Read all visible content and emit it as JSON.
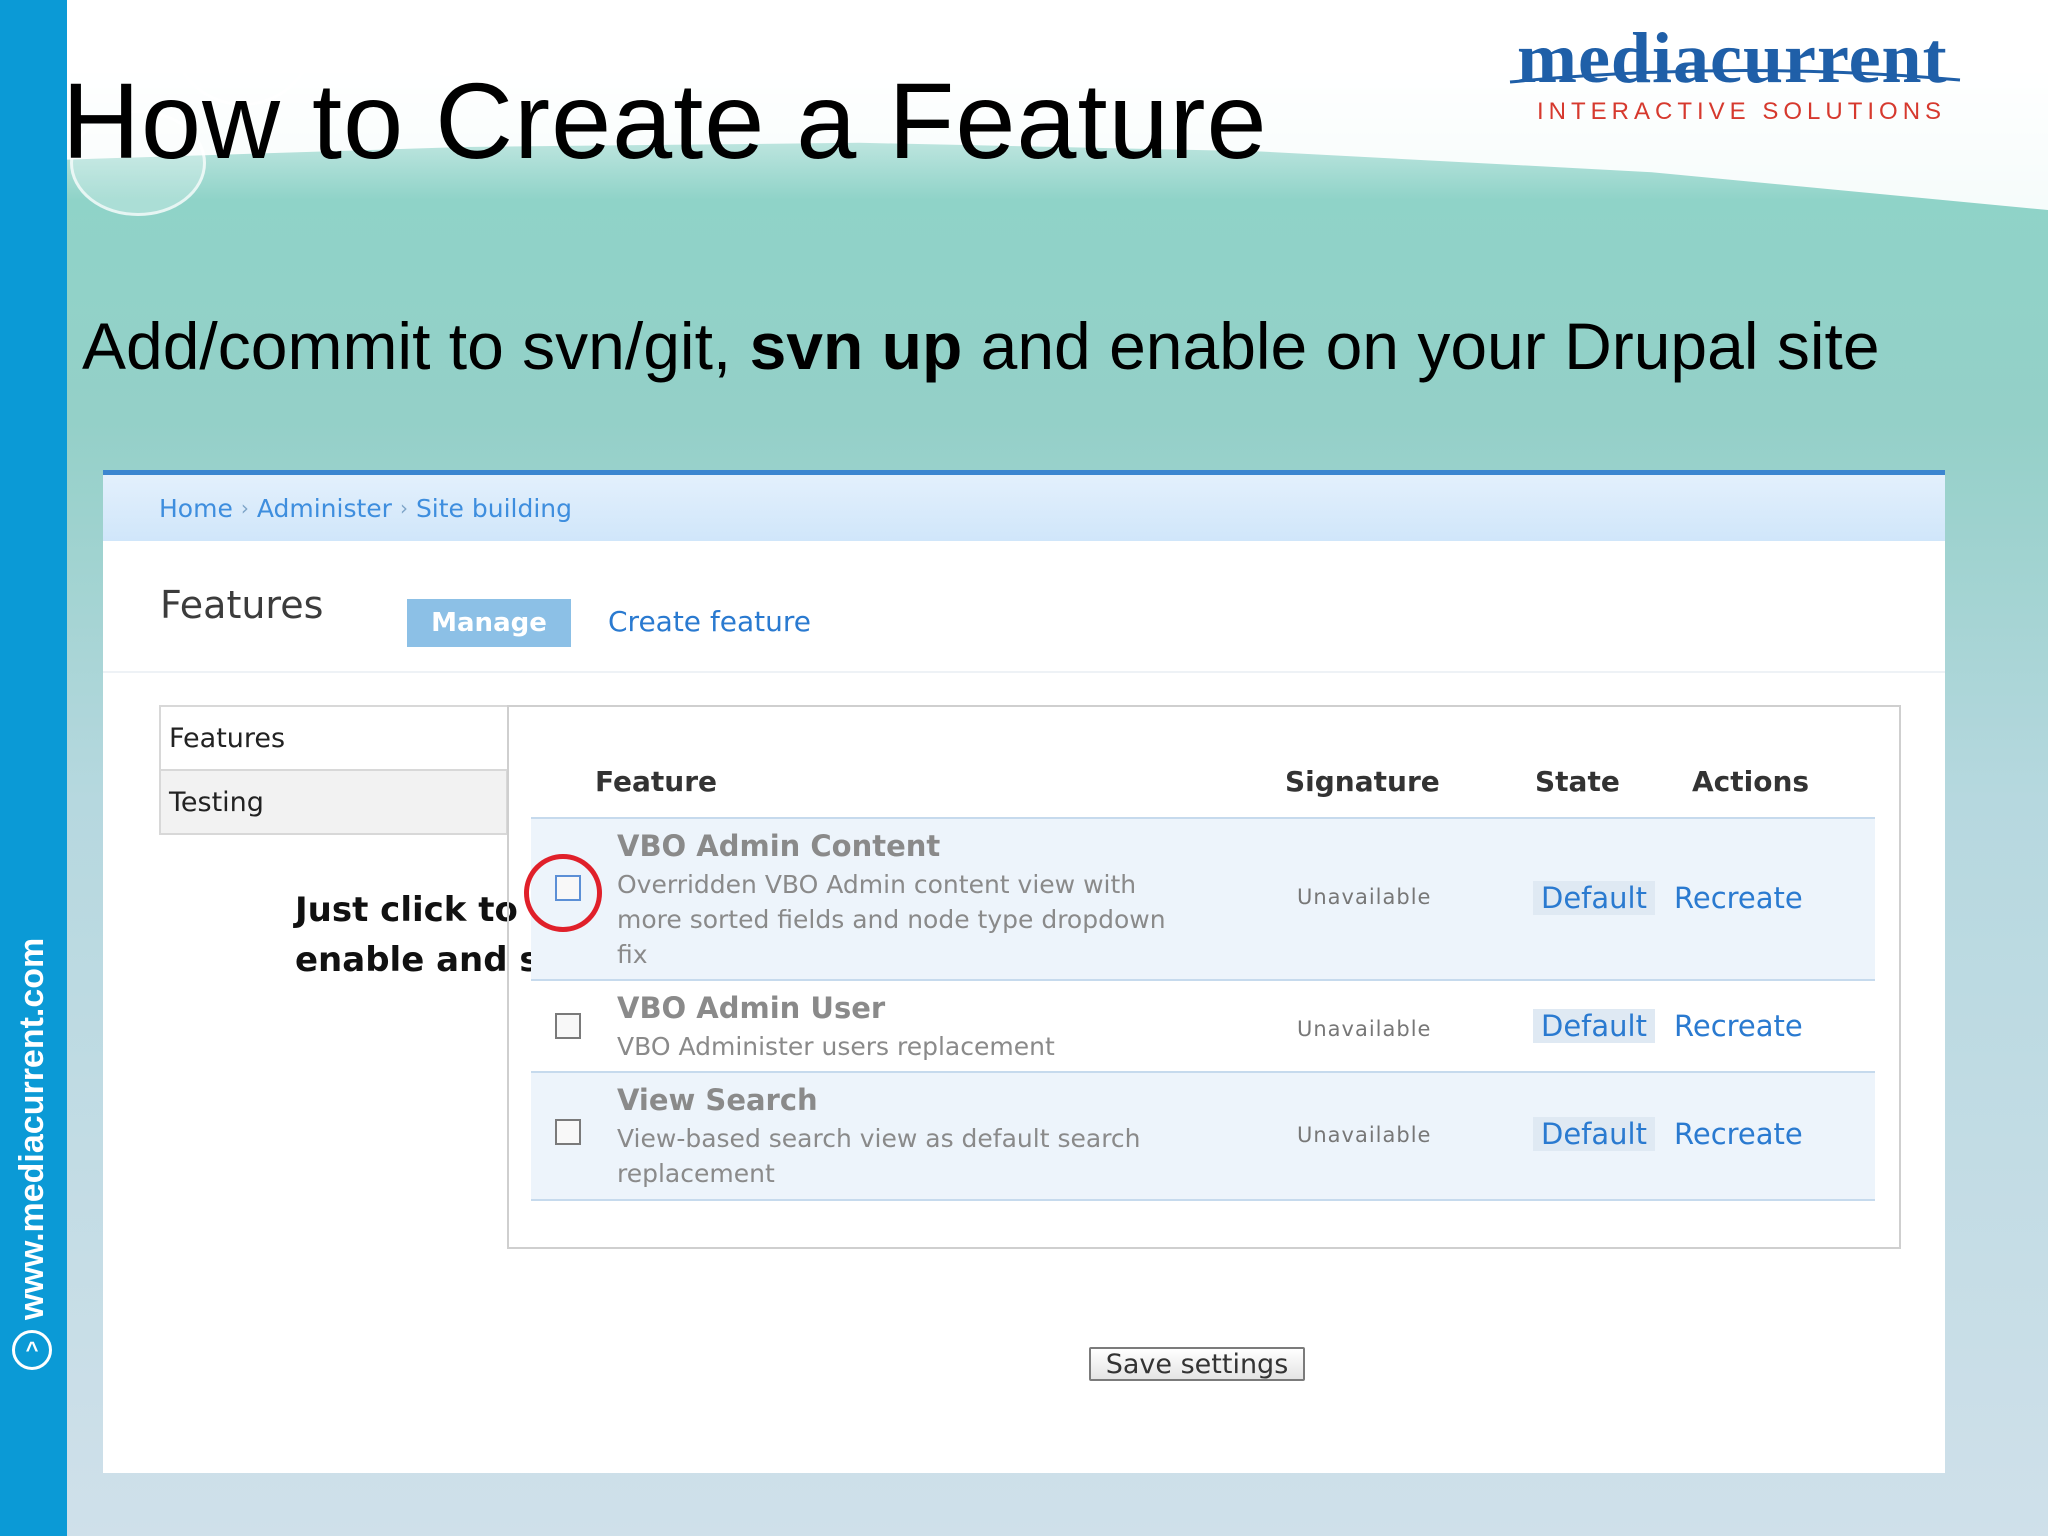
{
  "slide": {
    "title": "How to Create a Feature",
    "subtitle_pre": "Add/commit to svn/git, ",
    "subtitle_bold": "svn up",
    "subtitle_post": " and enable on your Drupal site",
    "side_url": "www.mediacurrent.com"
  },
  "logo": {
    "word": "mediacurrent",
    "tagline": "INTERACTIVE SOLUTIONS",
    "colors": {
      "word": "#1f5fa8",
      "tagline": "#d6392e"
    }
  },
  "breadcrumb": [
    "Home",
    "Administer",
    "Site building"
  ],
  "page": {
    "heading": "Features",
    "tabs": {
      "manage": "Manage",
      "create": "Create feature"
    }
  },
  "side_nav": [
    "Features",
    "Testing"
  ],
  "table": {
    "headers": {
      "feature": "Feature",
      "signature": "Signature",
      "state": "State",
      "actions": "Actions"
    },
    "rows": [
      {
        "name": "VBO Admin Content",
        "description": "Overridden VBO Admin content view with more sorted fields and node type dropdown fix",
        "signature": "Unavailable",
        "state": "Default",
        "action": "Recreate",
        "checked": false
      },
      {
        "name": "VBO Admin User",
        "description": "VBO Administer users replacement",
        "signature": "Unavailable",
        "state": "Default",
        "action": "Recreate",
        "checked": false
      },
      {
        "name": "View Search",
        "description": "View-based search view as default search replacement",
        "signature": "Unavailable",
        "state": "Default",
        "action": "Recreate",
        "checked": false
      }
    ]
  },
  "annotation": {
    "line1": "Just click to",
    "line2": "enable and save"
  },
  "save_button": "Save settings",
  "colors": {
    "left_bar": "#0b9ad6",
    "panel_top": "#3b86d0",
    "highlight_ring": "#e0202a",
    "link": "#2a7ad0"
  }
}
